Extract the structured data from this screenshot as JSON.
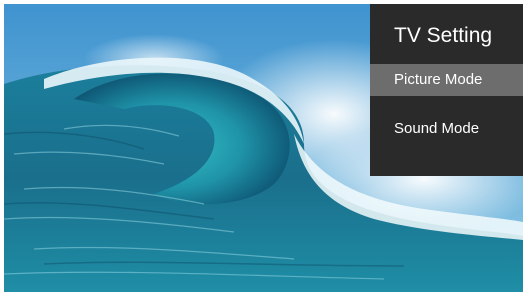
{
  "screen": {
    "background_image": "ocean-wave-photo"
  },
  "menu": {
    "title": "TV Setting",
    "items": [
      {
        "label": "Picture Mode",
        "selected": true
      },
      {
        "label": "Sound Mode",
        "selected": false
      }
    ],
    "colors": {
      "panel": "#2a2a2a",
      "selected": "#6d6d6d",
      "text": "#ffffff"
    }
  }
}
